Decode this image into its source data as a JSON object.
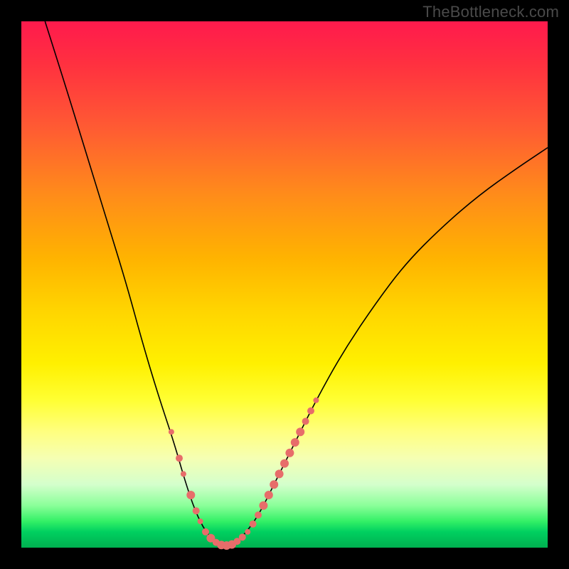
{
  "watermark": "TheBottleneck.com",
  "chart_data": {
    "type": "line",
    "title": "",
    "xlabel": "",
    "ylabel": "",
    "xlim": [
      0,
      100
    ],
    "ylim": [
      0,
      100
    ],
    "grid": false,
    "legend": false,
    "annotations": [],
    "curve": [
      {
        "x": 4.5,
        "y": 100
      },
      {
        "x": 8,
        "y": 89
      },
      {
        "x": 12,
        "y": 76
      },
      {
        "x": 16,
        "y": 63
      },
      {
        "x": 20,
        "y": 50
      },
      {
        "x": 23,
        "y": 39
      },
      {
        "x": 26,
        "y": 29
      },
      {
        "x": 29,
        "y": 20
      },
      {
        "x": 31,
        "y": 13
      },
      {
        "x": 33,
        "y": 7
      },
      {
        "x": 35,
        "y": 3
      },
      {
        "x": 37,
        "y": 1
      },
      {
        "x": 38.5,
        "y": 0.3
      },
      {
        "x": 40,
        "y": 0.5
      },
      {
        "x": 42,
        "y": 2
      },
      {
        "x": 45,
        "y": 6
      },
      {
        "x": 48,
        "y": 12
      },
      {
        "x": 52,
        "y": 20
      },
      {
        "x": 56,
        "y": 28
      },
      {
        "x": 61,
        "y": 37
      },
      {
        "x": 67,
        "y": 46
      },
      {
        "x": 73,
        "y": 54
      },
      {
        "x": 80,
        "y": 61
      },
      {
        "x": 87,
        "y": 67
      },
      {
        "x": 94,
        "y": 72
      },
      {
        "x": 100,
        "y": 76
      }
    ],
    "series": [
      {
        "name": "markers",
        "points": [
          {
            "x": 28.5,
            "y": 22,
            "r": 4
          },
          {
            "x": 30,
            "y": 17,
            "r": 5
          },
          {
            "x": 30.8,
            "y": 14,
            "r": 4
          },
          {
            "x": 32.2,
            "y": 10,
            "r": 6
          },
          {
            "x": 33.2,
            "y": 7,
            "r": 5
          },
          {
            "x": 34,
            "y": 5,
            "r": 4
          },
          {
            "x": 35,
            "y": 3,
            "r": 5
          },
          {
            "x": 36,
            "y": 1.8,
            "r": 6
          },
          {
            "x": 37,
            "y": 1,
            "r": 5
          },
          {
            "x": 38,
            "y": 0.5,
            "r": 6
          },
          {
            "x": 39,
            "y": 0.4,
            "r": 6
          },
          {
            "x": 40,
            "y": 0.6,
            "r": 6
          },
          {
            "x": 41,
            "y": 1.2,
            "r": 5
          },
          {
            "x": 42,
            "y": 2,
            "r": 5
          },
          {
            "x": 43,
            "y": 3,
            "r": 4
          },
          {
            "x": 44,
            "y": 4.5,
            "r": 5
          },
          {
            "x": 45,
            "y": 6.2,
            "r": 5
          },
          {
            "x": 46,
            "y": 8,
            "r": 6
          },
          {
            "x": 47,
            "y": 10,
            "r": 6
          },
          {
            "x": 48,
            "y": 12,
            "r": 6
          },
          {
            "x": 49,
            "y": 14,
            "r": 6
          },
          {
            "x": 50,
            "y": 16,
            "r": 6
          },
          {
            "x": 51,
            "y": 18,
            "r": 6
          },
          {
            "x": 52,
            "y": 20,
            "r": 6
          },
          {
            "x": 53,
            "y": 22,
            "r": 6
          },
          {
            "x": 54,
            "y": 24,
            "r": 5
          },
          {
            "x": 55,
            "y": 26,
            "r": 5
          },
          {
            "x": 56,
            "y": 28,
            "r": 4
          }
        ]
      }
    ]
  }
}
